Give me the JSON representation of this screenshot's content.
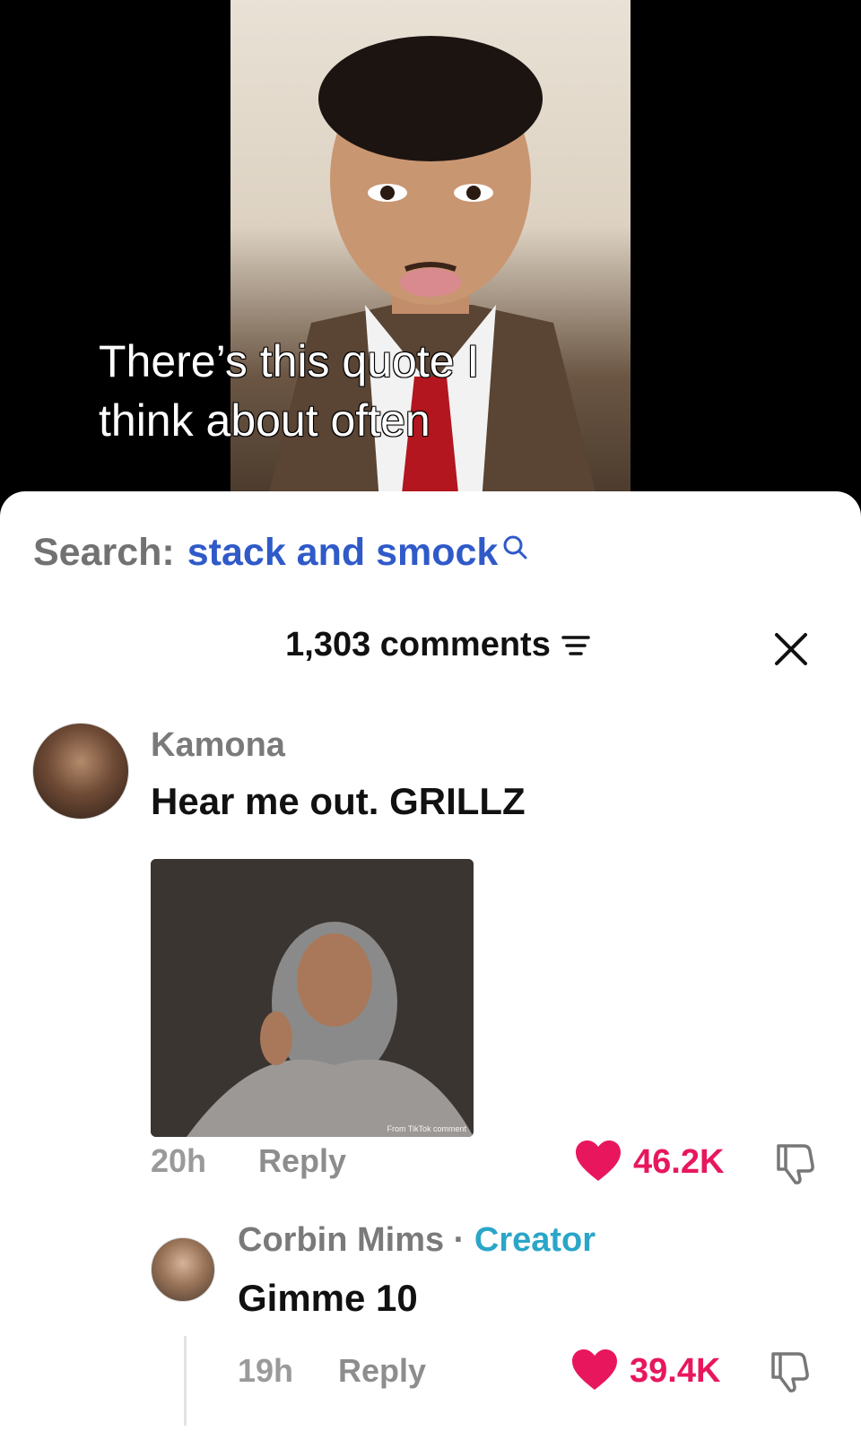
{
  "video": {
    "caption": "There’s this quote I\nthink about often"
  },
  "search": {
    "prefix": "Search:",
    "term": "stack and smock"
  },
  "comments": {
    "count_label": "1,303 comments"
  },
  "comment_main": {
    "username": "Kamona",
    "text": "Hear me out. GRILLZ",
    "image_watermark": "From TikTok comment",
    "time": "20h",
    "reply_label": "Reply",
    "likes": "46.2K"
  },
  "comment_reply": {
    "username": "Corbin Mims",
    "separator": " · ",
    "badge": "Creator",
    "text": "Gimme 10",
    "time": "19h",
    "reply_label": "Reply",
    "likes": "39.4K"
  },
  "colors": {
    "accent_like": "#e8175d",
    "search_term": "#2f5ac8",
    "creator": "#2aa6c8"
  }
}
